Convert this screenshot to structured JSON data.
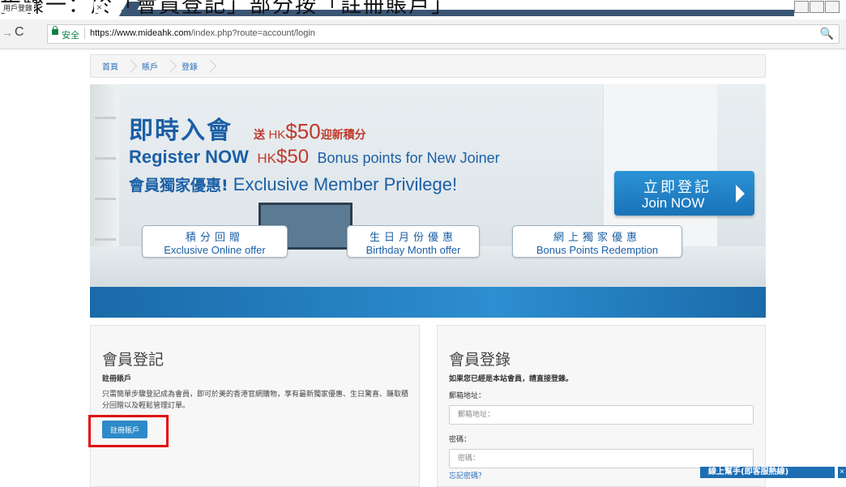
{
  "caption": "步驟一：於「會員登記」部分按「註冊賬戶」",
  "tab": {
    "title": "用戶登錄",
    "close": "×"
  },
  "addressbar": {
    "back": "→",
    "reload": "C",
    "secure_label": "安全",
    "url_host": "https://www.mideahk.com",
    "url_path": "/index.php?route=account/login",
    "zoom_icon": "🔍"
  },
  "breadcrumb": [
    "首頁",
    "賬戶",
    "登錄"
  ],
  "banner": {
    "line1_cn": "即時入會",
    "line1_give": "送",
    "hk": "HK",
    "amount": "$50",
    "line1_tail": "迎新積分",
    "line2_reg": "Register NOW",
    "line2_bonus": "Bonus points for New Joiner",
    "line3_cn": "會員獨家優惠!",
    "line3_en": " Exclusive Member Privilege!",
    "join_cn": "立即登記",
    "join_en": "Join NOW",
    "pills": [
      {
        "cn": "積分回贈",
        "en": "Exclusive Online offer"
      },
      {
        "cn": "生日月份優惠",
        "en": "Birthday Month offer"
      },
      {
        "cn": "網上獨家優惠",
        "en": "Bonus Points Redemption"
      }
    ]
  },
  "register": {
    "title": "會員登記",
    "subtitle": "註冊賬戶",
    "desc": "只需簡單步驟登記成為會員，即可於美的香港官網購物，享有最新獨家優惠、生日驚喜、賺取積分回贈以及輕鬆管理訂單。",
    "button": "註冊賬戶"
  },
  "login": {
    "title": "會員登錄",
    "subtitle": "如果您已經是本站會員，請直接登錄。",
    "email_label": "郵箱地址：",
    "email_placeholder": "郵箱地址：",
    "password_label": "密碼：",
    "password_placeholder": "密碼：",
    "forgot": "忘記密碼？"
  },
  "chat": {
    "label": "線上幫手(即客服熱線)",
    "close": "×"
  },
  "colors": {
    "accent": "#2d8ac9",
    "highlight": "#e01010",
    "brand": "#1b5fa6"
  }
}
